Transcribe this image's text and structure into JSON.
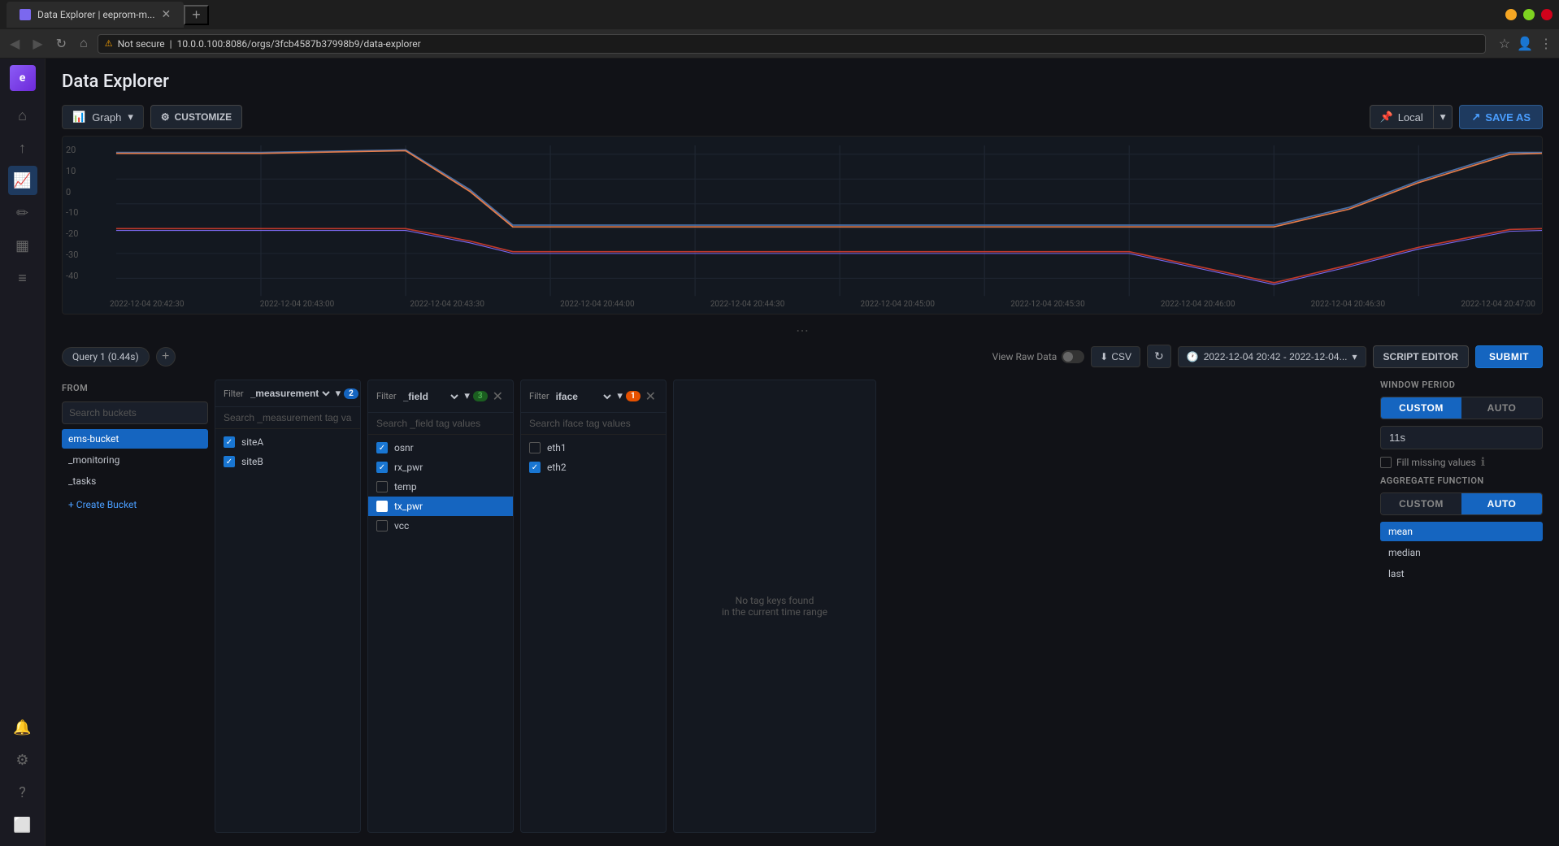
{
  "browser": {
    "tab_title": "Data Explorer | eeprom-m...",
    "url": "10.0.0.100:8086/orgs/3fcb4587b37998b9/data-explorer",
    "new_tab_btn": "+",
    "nav_back": "←",
    "nav_forward": "→",
    "nav_refresh": "↻",
    "security_label": "Not secure"
  },
  "sidebar": {
    "logo": "e",
    "items": [
      {
        "id": "home",
        "icon": "⌂",
        "active": false
      },
      {
        "id": "upload",
        "icon": "↑",
        "active": false
      },
      {
        "id": "chart",
        "icon": "📈",
        "active": true
      },
      {
        "id": "pencil",
        "icon": "✏",
        "active": false
      },
      {
        "id": "dashboard",
        "icon": "▦",
        "active": false
      },
      {
        "id": "tasks",
        "icon": "☰",
        "active": false
      },
      {
        "id": "alerts",
        "icon": "🔔",
        "active": false
      },
      {
        "id": "settings",
        "icon": "⚙",
        "active": false
      }
    ],
    "bottom_items": [
      {
        "id": "help",
        "icon": "?"
      },
      {
        "id": "terminal",
        "icon": "⬜"
      }
    ]
  },
  "page": {
    "title": "Data Explorer"
  },
  "toolbar": {
    "graph_label": "Graph",
    "customize_label": "CUSTOMIZE",
    "local_label": "Local",
    "save_as_label": "SAVE AS"
  },
  "chart": {
    "y_labels": [
      "20",
      "10",
      "0",
      "-10",
      "-20",
      "-30",
      "-40"
    ],
    "x_labels": [
      "2022-12-04 20:42:30",
      "2022-12-04 20:43:00",
      "2022-12-04 20:43:30",
      "2022-12-04 20:44:00",
      "2022-12-04 20:44:30",
      "2022-12-04 20:45:00",
      "2022-12-04 20:45:30",
      "2022-12-04 20:46:00",
      "2022-12-04 20:46:30",
      "2022-12-04 20:47:00"
    ]
  },
  "query_bar": {
    "query_label": "Query 1 (0.44s)",
    "add_btn": "+",
    "view_raw_label": "View Raw Data",
    "csv_label": "CSV",
    "time_range": "2022-12-04 20:42 - 2022-12-04...",
    "script_editor_label": "SCRIPT EDITOR",
    "submit_label": "SUBMIT"
  },
  "from_panel": {
    "label": "FROM",
    "search_placeholder": "Search buckets",
    "buckets": [
      {
        "name": "ems-bucket",
        "selected": true
      },
      {
        "name": "_monitoring",
        "selected": false
      },
      {
        "name": "_tasks",
        "selected": false
      }
    ],
    "create_label": "+ Create Bucket"
  },
  "filter1": {
    "field": "_measurement",
    "badge": "2",
    "search_placeholder": "Search _measurement tag va",
    "items": [
      {
        "name": "siteA",
        "checked": true,
        "selected": false
      },
      {
        "name": "siteB",
        "checked": true,
        "selected": false
      }
    ]
  },
  "filter2": {
    "field": "_field",
    "badge": "3",
    "search_placeholder": "Search _field tag values",
    "items": [
      {
        "name": "osnr",
        "checked": true,
        "selected": false
      },
      {
        "name": "rx_pwr",
        "checked": true,
        "selected": false
      },
      {
        "name": "temp",
        "checked": false,
        "selected": false
      },
      {
        "name": "tx_pwr",
        "checked": false,
        "selected": true
      },
      {
        "name": "vcc",
        "checked": false,
        "selected": false
      }
    ]
  },
  "filter3": {
    "field": "iface",
    "badge": "1",
    "search_placeholder": "Search iface tag values",
    "items": [
      {
        "name": "eth1",
        "checked": false,
        "selected": false
      },
      {
        "name": "eth2",
        "checked": true,
        "selected": false
      }
    ]
  },
  "empty_panel": {
    "line1": "No tag keys found",
    "line2": "in the current time range"
  },
  "right_panel": {
    "window_period_label": "WINDOW PERIOD",
    "custom_label": "CUSTOM",
    "auto_label": "AUTO",
    "period_value": "11s",
    "fill_missing_label": "Fill missing values",
    "aggregate_label": "AGGREGATE FUNCTION",
    "agg_custom_label": "CUSTOM",
    "agg_auto_label": "AUTO",
    "agg_items": [
      {
        "name": "mean",
        "selected": true
      },
      {
        "name": "median",
        "selected": false
      },
      {
        "name": "last",
        "selected": false
      }
    ]
  }
}
